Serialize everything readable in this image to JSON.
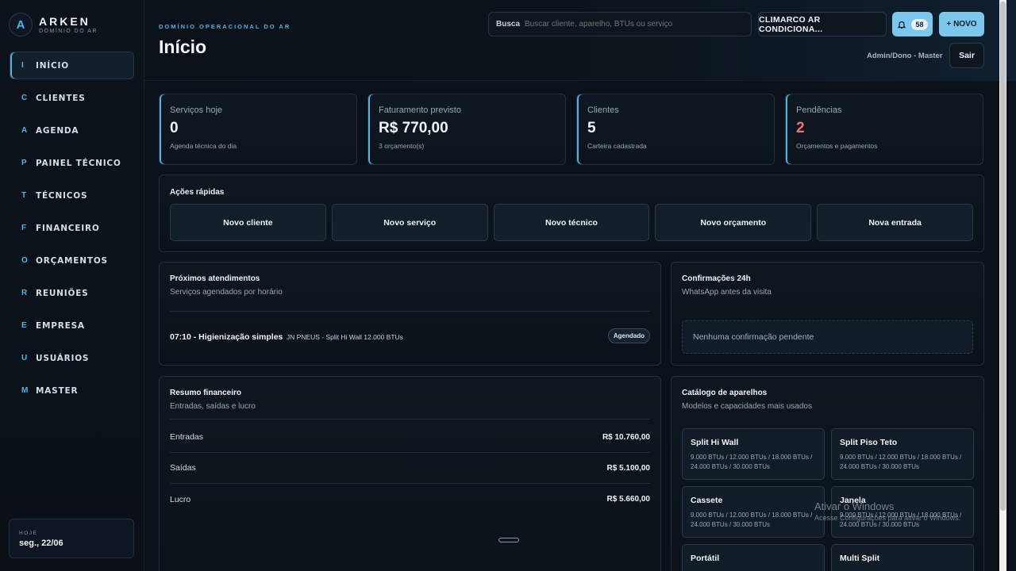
{
  "brand": {
    "name": "ARKEN",
    "subtitle": "DOMÍNIO DO AR",
    "logo_letter": "A"
  },
  "sidebar": {
    "items": [
      {
        "letter": "I",
        "label": "INÍCIO",
        "active": true
      },
      {
        "letter": "C",
        "label": "CLIENTES"
      },
      {
        "letter": "A",
        "label": "AGENDA"
      },
      {
        "letter": "P",
        "label": "PAINEL TÉCNICO"
      },
      {
        "letter": "T",
        "label": "TÉCNICOS"
      },
      {
        "letter": "F",
        "label": "FINANCEIRO"
      },
      {
        "letter": "O",
        "label": "ORÇAMENTOS"
      },
      {
        "letter": "R",
        "label": "REUNIÕES"
      },
      {
        "letter": "E",
        "label": "EMPRESA"
      },
      {
        "letter": "U",
        "label": "USUÁRIOS"
      },
      {
        "letter": "M",
        "label": "MASTER"
      }
    ],
    "today": {
      "label": "HOJE",
      "date": "seg., 22/06"
    }
  },
  "header": {
    "eyebrow": "DOMÍNIO OPERACIONAL DO AR",
    "title": "Início",
    "search": {
      "label": "Busca",
      "placeholder": "Buscar cliente, aparelho, BTUs ou serviço"
    },
    "company": "CLIMARCO AR CONDICIONA...",
    "notifications": {
      "count": "58",
      "icon": "bell-icon"
    },
    "new_button": "+ NOVO",
    "user_role": "Admin/Dono - Master",
    "logout": "Sair"
  },
  "kpis": [
    {
      "label": "Serviços hoje",
      "value": "0",
      "sub": "Agenda técnica do dia"
    },
    {
      "label": "Faturamento previsto",
      "value": "R$ 770,00",
      "sub": "3 orçamento(s)"
    },
    {
      "label": "Clientes",
      "value": "5",
      "sub": "Carteira cadastrada"
    },
    {
      "label": "Pendências",
      "value": "2",
      "sub": "Orçamentos e pagamentos",
      "alert": true
    }
  ],
  "quick_actions": {
    "title": "Ações rápidas",
    "buttons": [
      "Novo cliente",
      "Novo serviço",
      "Novo técnico",
      "Novo orçamento",
      "Nova entrada"
    ]
  },
  "next_appointments": {
    "title": "Próximos atendimentos",
    "subtitle": "Serviços agendados por horário",
    "items": [
      {
        "main": "07:10 - Higienização simples",
        "detail": "JN PNEUS - Split Hi Wall 12.000 BTUs",
        "status": "Agendado"
      }
    ]
  },
  "confirmations": {
    "title": "Confirmações 24h",
    "subtitle": "WhatsApp antes da visita",
    "empty": "Nenhuma confirmação pendente"
  },
  "finance": {
    "title": "Resumo financeiro",
    "subtitle": "Entradas, saídas e lucro",
    "rows": [
      {
        "label": "Entradas",
        "value": "R$ 10.760,00"
      },
      {
        "label": "Saídas",
        "value": "R$ 5.100,00"
      },
      {
        "label": "Lucro",
        "value": "R$ 5.660,00"
      }
    ]
  },
  "catalog": {
    "title": "Catálogo de aparelhos",
    "subtitle": "Modelos e capacidades mais usados",
    "items": [
      {
        "name": "Split Hi Wall",
        "capacities": "9.000 BTUs / 12.000 BTUs / 18.000 BTUs / 24.000 BTUs / 30.000 BTUs"
      },
      {
        "name": "Split Piso Teto",
        "capacities": "9.000 BTUs / 12.000 BTUs / 18.000 BTUs / 24.000 BTUs / 30.000 BTUs"
      },
      {
        "name": "Cassete",
        "capacities": "9.000 BTUs / 12.000 BTUs / 18.000 BTUs / 24.000 BTUs / 30.000 BTUs"
      },
      {
        "name": "Janela",
        "capacities": "9.000 BTUs / 12.000 BTUs / 18.000 BTUs / 24.000 BTUs / 30.000 BTUs"
      },
      {
        "name": "Portátil",
        "capacities": ""
      },
      {
        "name": "Multi Split",
        "capacities": ""
      }
    ]
  },
  "watermark": {
    "title": "Ativar o Windows",
    "subtitle": "Acesse Configurações para ativar o Windows."
  },
  "colors": {
    "accent": "#4fb3e6",
    "button": "#7cc7ec",
    "alert": "#f0707a",
    "background": "#0b1118"
  }
}
